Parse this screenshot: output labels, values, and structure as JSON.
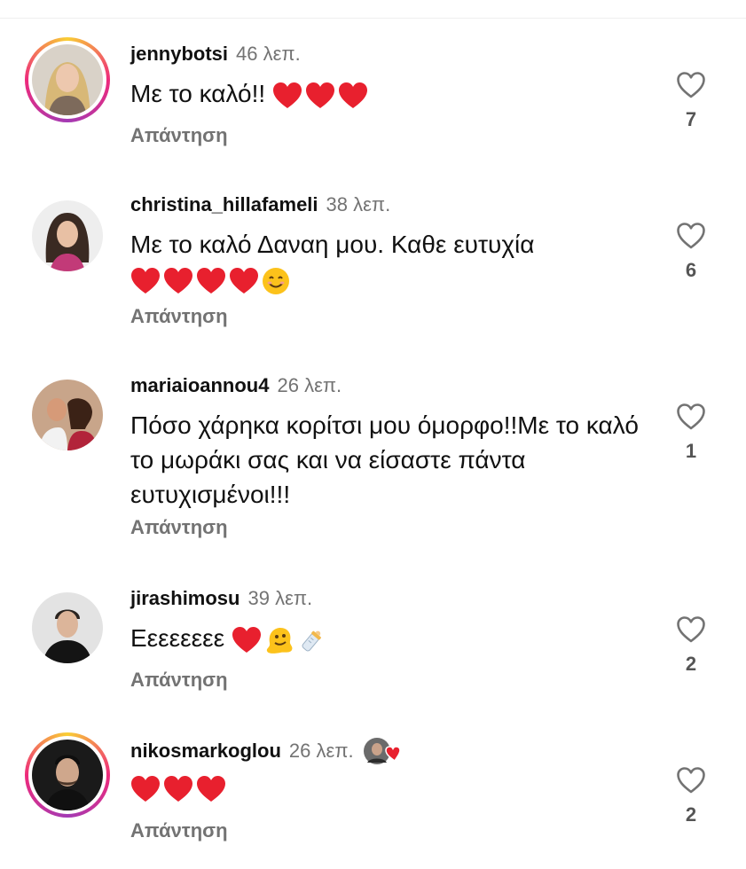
{
  "comments": [
    {
      "username": "jennybotsi",
      "time": "46 λεπ.",
      "text": "Με το καλό!!",
      "reply_label": "Απάντηση",
      "likes": "7",
      "emoji": [
        "red-heart",
        "red-heart",
        "red-heart"
      ],
      "story_ring": true
    },
    {
      "username": "christina_hillafameli",
      "time": "38 λεπ.",
      "text": "Με το καλό Δαναη μου. Καθε ευτυχία",
      "reply_label": "Απάντηση",
      "likes": "6",
      "emoji": [
        "red-heart",
        "red-heart",
        "red-heart",
        "red-heart",
        "smiling-face"
      ],
      "story_ring": false
    },
    {
      "username": "mariaioannou4",
      "time": "26 λεπ.",
      "text": "Πόσο χάρηκα κορίτσι μου όμορφο!!Με το καλό το μωράκι σας και να είσαστε πάντα ευτυχισμένοι!!!",
      "reply_label": "Απάντηση",
      "likes": "1",
      "emoji": [],
      "story_ring": false
    },
    {
      "username": "jirashimosu",
      "time": "39 λεπ.",
      "text": "Εεεεεεεε",
      "reply_label": "Απάντηση",
      "likes": "2",
      "emoji": [
        "red-heart",
        "melting-face",
        "baby-bottle"
      ],
      "story_ring": false
    },
    {
      "username": "nikosmarkoglou",
      "time": "26 λεπ.",
      "text": "",
      "reply_label": "Απάντηση",
      "likes": "2",
      "emoji": [
        "red-heart",
        "red-heart",
        "red-heart"
      ],
      "story_ring": true,
      "creator_liked": true
    }
  ],
  "colors": {
    "heart": "#e8202e",
    "muted": "#737373",
    "ring_start": "#f9ce34",
    "ring_end": "#a33ab4"
  }
}
